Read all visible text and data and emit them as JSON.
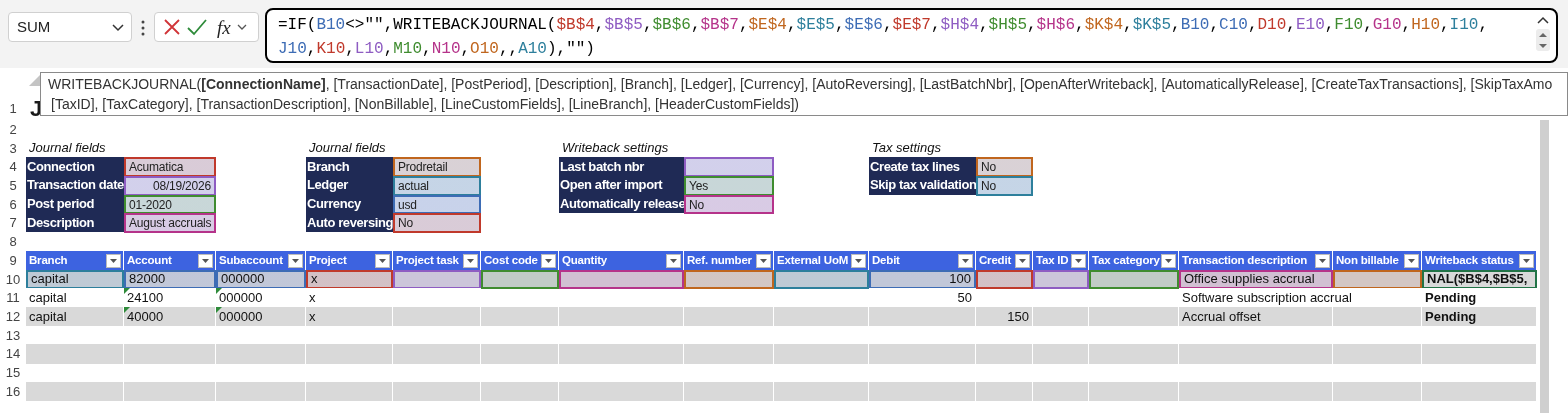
{
  "name_box": {
    "value": "SUM"
  },
  "formula_bar": {
    "insert_function_label": "fx",
    "lines": [
      [
        {
          "text": "=IF("
        },
        {
          "ref": "B10",
          "color": "#3d6cb5"
        },
        {
          "text": "<>\"\",WRITEBACKJOURNAL("
        },
        {
          "ref": "$B$4",
          "color": "#c0392b",
          "after": ","
        },
        {
          "ref": "$B$5",
          "color": "#8e5cc2",
          "after": ","
        },
        {
          "ref": "$B$6",
          "color": "#3f8c2f",
          "after": ","
        },
        {
          "ref": "$B$7",
          "color": "#b5338a",
          "after": ","
        },
        {
          "ref": "$E$4",
          "color": "#c0661e",
          "after": ","
        },
        {
          "ref": "$E$5",
          "color": "#2d7f9c",
          "after": ","
        },
        {
          "ref": "$E$6",
          "color": "#3d6cb5",
          "after": ","
        },
        {
          "ref": "$E$7",
          "color": "#c0392b",
          "after": ","
        },
        {
          "ref": "$H$4",
          "color": "#8e5cc2",
          "after": ","
        },
        {
          "ref": "$H$5",
          "color": "#3f8c2f",
          "after": ","
        },
        {
          "ref": "$H$6",
          "color": "#b5338a",
          "after": ","
        },
        {
          "ref": "$K$4",
          "color": "#c0661e",
          "after": ","
        },
        {
          "ref": "$K$5",
          "color": "#2d7f9c",
          "after": ","
        },
        {
          "ref": "B10",
          "color": "#3d6cb5",
          "after": ","
        },
        {
          "ref": "C10",
          "color": "#3d6cb5",
          "after": ","
        },
        {
          "ref": "D10",
          "color": "#c0392b",
          "after": ","
        },
        {
          "ref": "E10",
          "color": "#8e5cc2",
          "after": ","
        },
        {
          "ref": "F10",
          "color": "#3f8c2f",
          "after": ","
        },
        {
          "ref": "G10",
          "color": "#b5338a",
          "after": ","
        },
        {
          "ref": "H10",
          "color": "#c0661e",
          "after": ","
        },
        {
          "ref": "I10",
          "color": "#2d7f9c",
          "after": ","
        }
      ],
      [
        {
          "ref": "J10",
          "color": "#3d6cb5",
          "after": ","
        },
        {
          "ref": "K10",
          "color": "#c0392b",
          "after": ","
        },
        {
          "ref": "L10",
          "color": "#8e5cc2",
          "after": ","
        },
        {
          "ref": "M10",
          "color": "#3f8c2f",
          "after": ","
        },
        {
          "ref": "N10",
          "color": "#b5338a",
          "after": ","
        },
        {
          "ref": "O10",
          "color": "#c0661e",
          "after": ",,"
        },
        {
          "ref": "A10",
          "color": "#2d7f9c"
        },
        {
          "text": "),\"\")"
        }
      ]
    ]
  },
  "tooltip": {
    "lines": [
      "WRITEBACKJOURNAL(**[ConnectionName]**, [TransactionDate], [PostPeriod], [Description], [Branch], [Ledger], [Currency], [AutoReversing], [LastBatchNbr], [OpenAfterWriteback], [AutomaticallyRelease], [CreateTaxTransactions], [SkipTaxAmo",
      "[TaxID], [TaxCategory], [TransactionDescription], [NonBillable], [LineCustomFields], [LineBranch], [HeaderCustomFields])"
    ]
  },
  "sheet": {
    "row_numbers": [
      "1",
      "2",
      "3",
      "4",
      "5",
      "6",
      "7",
      "8",
      "9",
      "10",
      "11",
      "12",
      "13",
      "14",
      "15",
      "16"
    ],
    "title": "J",
    "sections": [
      {
        "title": "Journal fields",
        "fields": [
          {
            "label": "Connection",
            "value": "Acumatica",
            "color": "#c0392b"
          },
          {
            "label": "Transaction date",
            "value": "08/19/2026",
            "color": "#8e5cc2",
            "kind": "date"
          },
          {
            "label": "Post period",
            "value": "01-2020",
            "color": "#3f8c2f"
          },
          {
            "label": "Description",
            "value": "August accruals",
            "color": "#b5338a"
          }
        ]
      },
      {
        "title": "Journal fields",
        "fields": [
          {
            "label": "Branch",
            "value": "Prodretail",
            "color": "#c0661e"
          },
          {
            "label": "Ledger",
            "value": "actual",
            "color": "#2d7f9c"
          },
          {
            "label": "Currency",
            "value": "usd",
            "color": "#3d6cb5"
          },
          {
            "label": "Auto reversing",
            "value": "No",
            "color": "#c0392b"
          }
        ]
      },
      {
        "title": "Writeback settings",
        "fields": [
          {
            "label": "Last batch nbr",
            "color": "#8e5cc2"
          },
          {
            "label": "Open after import",
            "value": "Yes",
            "color": "#3f8c2f"
          },
          {
            "label": "Automatically release",
            "value": "No",
            "color": "#b5338a"
          }
        ]
      },
      {
        "title": "Tax settings",
        "fields": [
          {
            "label": "Create tax lines",
            "value": "No",
            "color": "#c0661e"
          },
          {
            "label": "Skip tax validation",
            "value": "No",
            "color": "#2d7f9c"
          }
        ]
      }
    ],
    "table": {
      "columns": [
        {
          "label": "Branch"
        },
        {
          "label": "Account"
        },
        {
          "label": "Subaccount"
        },
        {
          "label": "Project"
        },
        {
          "label": "Project task"
        },
        {
          "label": "Cost code"
        },
        {
          "label": "Quantity"
        },
        {
          "label": "Ref. number"
        },
        {
          "label": "External UoM"
        },
        {
          "label": "Debit",
          "kind": "number"
        },
        {
          "label": "Credit",
          "kind": "number"
        },
        {
          "label": "Tax ID"
        },
        {
          "label": "Tax category"
        },
        {
          "label": "Transaction description"
        },
        {
          "label": "Non billable"
        },
        {
          "label": "Writeback status",
          "kind": "status"
        }
      ],
      "rows": [
        {
          "cells": [
            {
              "text": "capital",
              "color": "#2d7f9c"
            },
            {
              "text": "82000",
              "color": "#3d6cb5"
            },
            {
              "text": "000000",
              "color": "#3d6cb5"
            },
            {
              "text": "x",
              "color": "#c0392b"
            },
            {
              "color": "#8e5cc2"
            },
            {
              "color": "#3f8c2f"
            },
            {
              "color": "#b5338a"
            },
            {
              "color": "#c0661e"
            },
            {
              "color": "#2d7f9c"
            },
            {
              "text": "100",
              "color": "#3d6cb5"
            },
            {
              "color": "#c0392b"
            },
            {
              "color": "#8e5cc2"
            },
            {
              "color": "#3f8c2f"
            },
            {
              "text": "Office supplies accrual",
              "color": "#b5338a"
            },
            {
              "color": "#c0661e"
            },
            {
              "text": "NAL($B$4,$B$5,",
              "active": true
            }
          ]
        },
        {
          "cells": [
            {
              "text": "capital"
            },
            {
              "text": "24100",
              "flag": true
            },
            {
              "text": "000000",
              "flag": true
            },
            {
              "text": "x"
            },
            {},
            {},
            {},
            {},
            {},
            {
              "text": "50"
            },
            {},
            {},
            {},
            {
              "text": "Software subscription accrual"
            },
            {},
            {
              "text": "Pending"
            }
          ]
        },
        {
          "cells": [
            {
              "text": "capital"
            },
            {
              "text": "40000",
              "flag": true
            },
            {
              "text": "000000",
              "flag": true
            },
            {
              "text": "x"
            },
            {},
            {},
            {},
            {},
            {},
            {},
            {
              "text": "150"
            },
            {},
            {},
            {
              "text": "Accrual offset"
            },
            {},
            {
              "text": "Pending"
            }
          ]
        }
      ]
    }
  }
}
